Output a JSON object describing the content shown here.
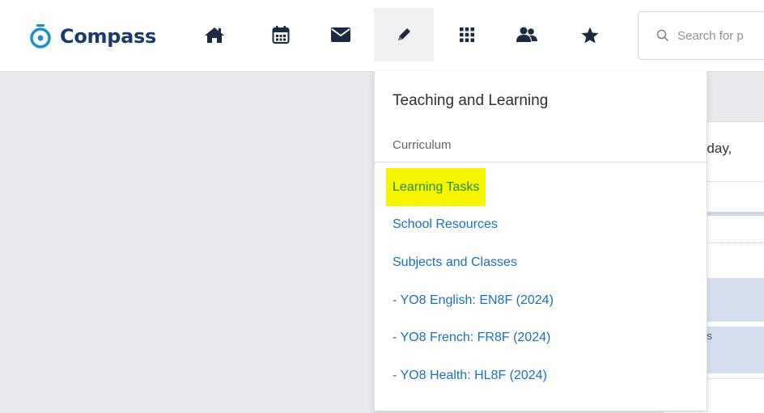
{
  "app": {
    "name": "Compass"
  },
  "nav": {
    "items": [
      {
        "icon": "home-icon"
      },
      {
        "icon": "calendar-icon"
      },
      {
        "icon": "mail-icon"
      },
      {
        "icon": "pencil-icon",
        "active": true
      },
      {
        "icon": "apps-grid-icon"
      },
      {
        "icon": "people-icon"
      },
      {
        "icon": "star-icon"
      }
    ]
  },
  "search": {
    "placeholder": "Search for p"
  },
  "dropdown": {
    "title": "Teaching and Learning",
    "section": "Curriculum",
    "items": [
      {
        "label": "Learning Tasks",
        "highlighted": true
      },
      {
        "label": "School Resources"
      },
      {
        "label": "Subjects and Classes"
      },
      {
        "label": "- YO8 English: EN8F (2024)"
      },
      {
        "label": "- YO8 French: FR8F (2024)"
      },
      {
        "label": "- YO8 Health: HL8F (2024)"
      }
    ]
  },
  "background": {
    "date_fragment": "nesday,",
    "block_label": "NS"
  },
  "colors": {
    "brand": "#1b3a6b",
    "link": "#1a6fc4",
    "highlight": "#f5f500",
    "icon": "#1b2a3f"
  }
}
